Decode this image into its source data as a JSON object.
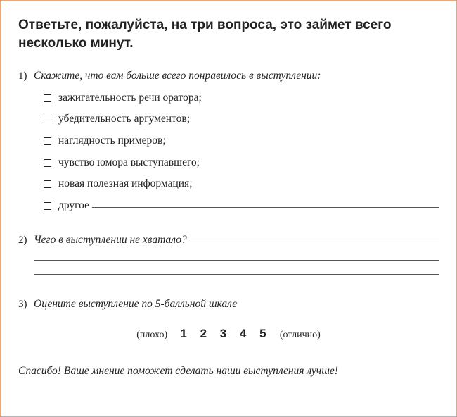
{
  "title": "Ответьте, пожалуйста, на три вопроса, это займет всего несколько минут.",
  "q1": {
    "num": "1)",
    "text": "Скажите, что вам больше всего понравилось в выступлении:",
    "options": [
      "зажигательность речи оратора;",
      "убедительность аргументов;",
      "наглядность примеров;",
      "чувство юмора выступавшего;",
      "новая полезная информация;"
    ],
    "other_label": "другое"
  },
  "q2": {
    "num": "2)",
    "text": "Чего в выступлении не хватало?"
  },
  "q3": {
    "num": "3)",
    "text": "Оцените выступление по 5-балльной шкале",
    "low": "(плохо)",
    "high": "(отлично)",
    "scale": [
      "1",
      "2",
      "3",
      "4",
      "5"
    ]
  },
  "thanks": "Спасибо! Ваше мнение поможет сделать наши выступления лучше!"
}
